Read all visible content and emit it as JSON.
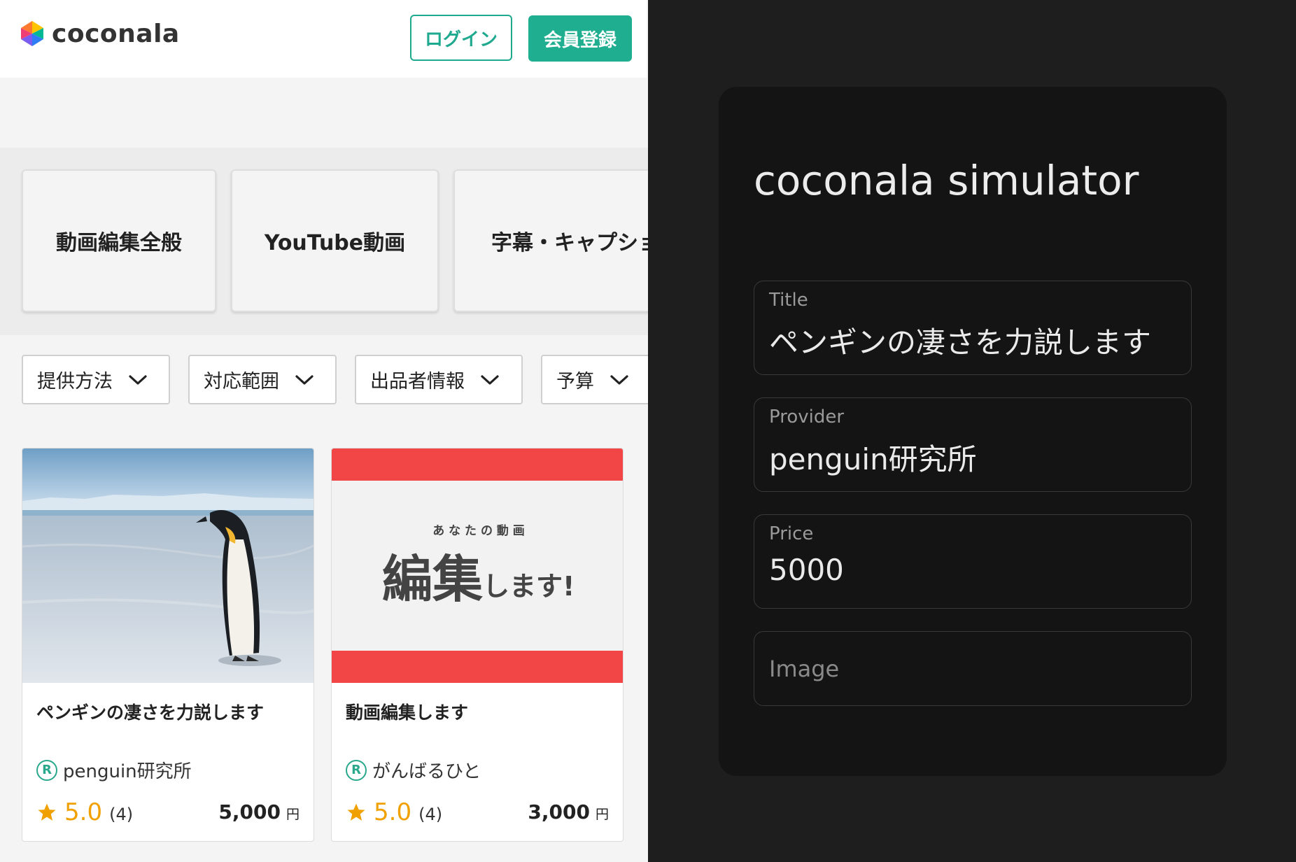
{
  "header": {
    "logo_text": "coconala",
    "login_label": "ログイン",
    "register_label": "会員登録"
  },
  "categories": [
    {
      "label": "動画編集全般"
    },
    {
      "label": "YouTube動画"
    },
    {
      "label": "字幕・キャプショ"
    }
  ],
  "filters": [
    {
      "label": "提供方法"
    },
    {
      "label": "対応範囲"
    },
    {
      "label": "出品者情報"
    },
    {
      "label": "予算"
    }
  ],
  "listings": [
    {
      "title": "ペンギンの凄さを力説します",
      "seller": "penguin研究所",
      "badge": "R",
      "score": "5.0",
      "count": "(4)",
      "price": "5,000",
      "unit": "円"
    },
    {
      "title": "動画編集します",
      "seller": "がんばるひと",
      "badge": "R",
      "score": "5.0",
      "count": "(4)",
      "price": "3,000",
      "unit": "円",
      "thumb_small": "あ な た の 動 画",
      "thumb_big": "編集",
      "thumb_suffix": "します!"
    }
  ],
  "simulator": {
    "title": "coconala simulator",
    "fields": {
      "title_label": "Title",
      "title_value": "ペンギンの凄さを力説します",
      "provider_label": "Provider",
      "provider_value": "penguin研究所",
      "price_label": "Price",
      "price_value": "5000",
      "image_label": "Image"
    }
  },
  "colors": {
    "brand_green": "#1fae90",
    "thumb_red": "#f24646",
    "rating_orange": "#f0a000",
    "panel_bg": "#141414"
  }
}
